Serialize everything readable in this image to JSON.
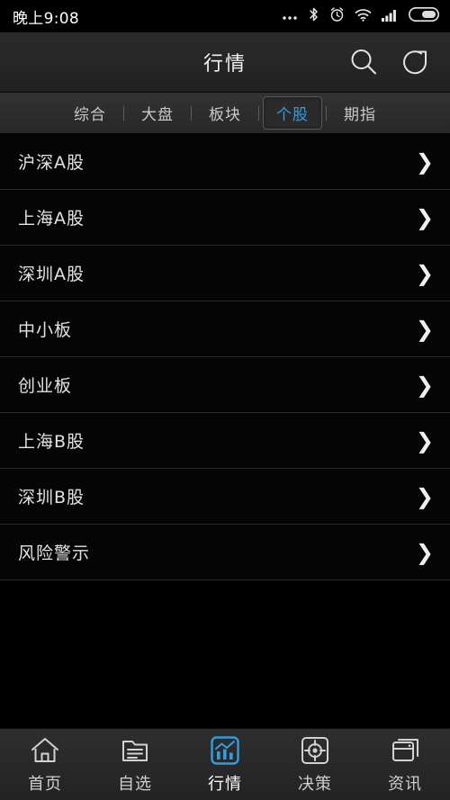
{
  "statusbar": {
    "time": "晚上9:08",
    "icons": [
      {
        "name": "more-icon",
        "glyph": "…"
      },
      {
        "name": "bluetooth-icon",
        "glyph": "bluetooth"
      },
      {
        "name": "alarm-clock-icon",
        "glyph": "alarm"
      },
      {
        "name": "wifi-icon",
        "glyph": "wifi"
      },
      {
        "name": "cellular-signal-icon",
        "glyph": "signal"
      },
      {
        "name": "battery-icon",
        "glyph": "battery"
      }
    ]
  },
  "header": {
    "title": "行情",
    "search_icon": "search-icon",
    "refresh_icon": "refresh-icon"
  },
  "tabs": [
    {
      "label": "综合",
      "active": false
    },
    {
      "label": "大盘",
      "active": false
    },
    {
      "label": "板块",
      "active": false
    },
    {
      "label": "个股",
      "active": true
    },
    {
      "label": "期指",
      "active": false
    }
  ],
  "list": {
    "chevron": "❯",
    "items": [
      {
        "label": "沪深A股"
      },
      {
        "label": "上海A股"
      },
      {
        "label": "深圳A股"
      },
      {
        "label": "中小板"
      },
      {
        "label": "创业板"
      },
      {
        "label": "上海B股"
      },
      {
        "label": "深圳B股"
      },
      {
        "label": "风险警示"
      }
    ]
  },
  "bottomnav": [
    {
      "label": "首页",
      "icon": "home-icon",
      "active": false
    },
    {
      "label": "自选",
      "icon": "document-list-icon",
      "active": false
    },
    {
      "label": "行情",
      "icon": "chart-icon",
      "active": true
    },
    {
      "label": "决策",
      "icon": "target-icon",
      "active": false
    },
    {
      "label": "资讯",
      "icon": "news-window-icon",
      "active": false
    }
  ],
  "colors": {
    "accent": "#2f9fe0",
    "background": "#000000",
    "bar": "#272727",
    "text": "#e2e2e2",
    "divider": "#2a2a2a"
  }
}
